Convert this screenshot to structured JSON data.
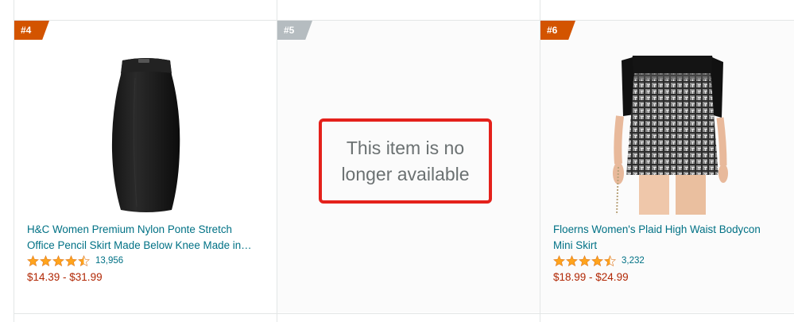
{
  "cards": [
    {
      "rank": "#4",
      "badge_color": "#d35400",
      "title_line1": "H&C Women Premium Nylon Ponte Stretch",
      "title_line2": "Office Pencil Skirt Made Below Knee Made in…",
      "rating": 4.5,
      "reviews": "13,956",
      "price": "$14.39 - $31.99",
      "image": "black-pencil-skirt"
    },
    {
      "rank": "#5",
      "badge_color": "#b5bcc0",
      "unavailable_line1": "This item is no",
      "unavailable_line2": "longer available"
    },
    {
      "rank": "#6",
      "badge_color": "#d35400",
      "title_line1": "Floerns Women's Plaid High Waist Bodycon",
      "title_line2": "Mini Skirt",
      "rating": 4.5,
      "reviews": "3,232",
      "price": "$18.99 - $24.99",
      "image": "plaid-mini-skirt"
    }
  ],
  "colors": {
    "link": "#007185",
    "price": "#B12704",
    "star": "#FFA41C",
    "highlight_border": "#e4211b"
  }
}
